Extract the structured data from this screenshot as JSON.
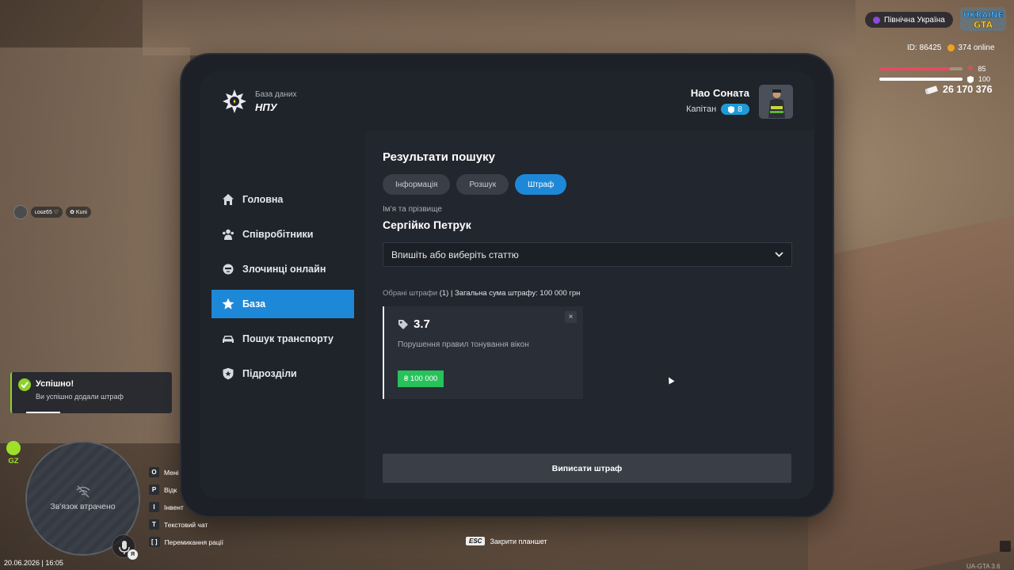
{
  "hud": {
    "server_name": "Північна Україна",
    "logo_text_top": "UKRAINE",
    "logo_text_bottom": "GTA",
    "player_id": "ID: 86425",
    "online": "374 online",
    "health": "85",
    "armor": "100",
    "health_level": 0.85,
    "armor_level": 1.0,
    "money": "26 170 376",
    "player_tag_name": "ʟᴏɢᴇ65 ♡",
    "player_tag_org": "Kuni",
    "gz_label": "GZ",
    "minimap_text": "Зв'язок втрачено",
    "mic_key": "Я",
    "datetime": "20.06.2026 | 16:05",
    "esc_key": "ESC",
    "esc_label": "Закрити планшет",
    "version": "UA-GTA 3.6",
    "keys": [
      {
        "key": "O",
        "label": "Мені"
      },
      {
        "key": "P",
        "label": "Відк"
      },
      {
        "key": "I",
        "label": "Інвент"
      },
      {
        "key": "T",
        "label": "Текстовий чат"
      },
      {
        "key": "[   ]",
        "label": "Перемикання рації"
      }
    ],
    "colors": {
      "health": "#e84a5f",
      "armor": "#ffffff",
      "success": "#8dd12a"
    }
  },
  "toast": {
    "title": "Успішно!",
    "text": "Ви успішно додали штраф"
  },
  "tablet": {
    "brand_sub": "База даних",
    "brand_name": "НПУ",
    "user": {
      "name": "Нао Соната",
      "rank": "Капітан",
      "rank_level": "8"
    },
    "nav": [
      {
        "label": "Головна",
        "icon": "home-icon"
      },
      {
        "label": "Співробітники",
        "icon": "users-icon"
      },
      {
        "label": "Злочинці онлайн",
        "icon": "criminal-icon"
      },
      {
        "label": "База",
        "icon": "star-icon",
        "active": true
      },
      {
        "label": "Пошук транспорту",
        "icon": "car-icon"
      },
      {
        "label": "Підрозділи",
        "icon": "shield-icon"
      }
    ],
    "section_title": "Результати пошуку",
    "tabs": [
      {
        "label": "Інформація"
      },
      {
        "label": "Розшук"
      },
      {
        "label": "Штраф",
        "active": true
      }
    ],
    "name_label": "Ім'я та прізвище",
    "person_name": "Сергійко Петрук",
    "article_select": "Впишіть або виберіть статтю",
    "summary_prefix": "Обрані штрафи",
    "summary_rest": "(1) | Загальна сума штрафу: 100 000 грн",
    "fine": {
      "code": "3.7",
      "description": "Порушення правил тонування вікон",
      "price": "₴ 100 000",
      "close": "×"
    },
    "submit": "Виписати штраф",
    "colors": {
      "accent": "#1e88d8",
      "price": "#27c25a"
    }
  }
}
